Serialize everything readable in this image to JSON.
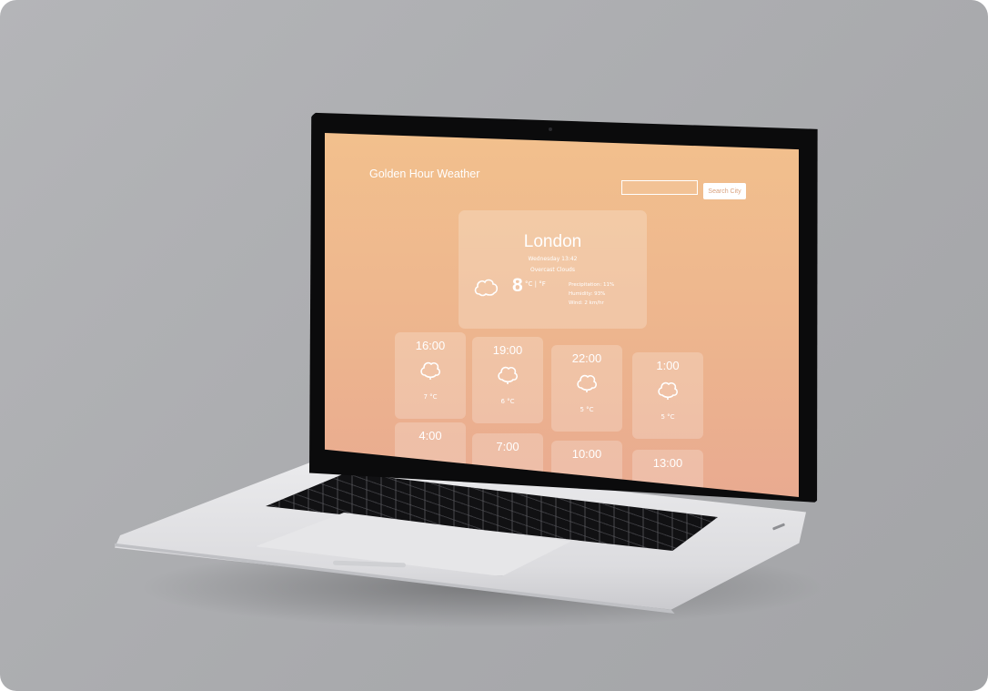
{
  "app": {
    "title": "Golden Hour Weather"
  },
  "search": {
    "placeholder": "",
    "value": "",
    "button_label": "Search City"
  },
  "current": {
    "city": "London",
    "datetime": "Wednesday 13:42",
    "description": "Overcast Clouds",
    "temperature": "8",
    "units": "°C | °F",
    "precipitation": "Precipitation: 11%",
    "humidity": "Humidity: 93%",
    "wind": "Wind: 2 km/hr",
    "icon": "cloud-icon"
  },
  "forecast": [
    {
      "time": "16:00",
      "temp": "7 °C",
      "icon": "cloud-icon"
    },
    {
      "time": "19:00",
      "temp": "6 °C",
      "icon": "cloud-icon"
    },
    {
      "time": "22:00",
      "temp": "5 °C",
      "icon": "cloud-icon"
    },
    {
      "time": "1:00",
      "temp": "5 °C",
      "icon": "cloud-icon"
    },
    {
      "time": "4:00",
      "temp": "",
      "icon": ""
    },
    {
      "time": "7:00",
      "temp": "",
      "icon": ""
    },
    {
      "time": "10:00",
      "temp": "",
      "icon": ""
    },
    {
      "time": "13:00",
      "temp": "",
      "icon": ""
    }
  ],
  "colors": {
    "background": "#a9aaad",
    "screen_gradient_top": "#f2c08d",
    "screen_gradient_bottom": "#e9aa90",
    "card": "rgba(255,255,255,0.22)",
    "text": "#ffffff"
  }
}
